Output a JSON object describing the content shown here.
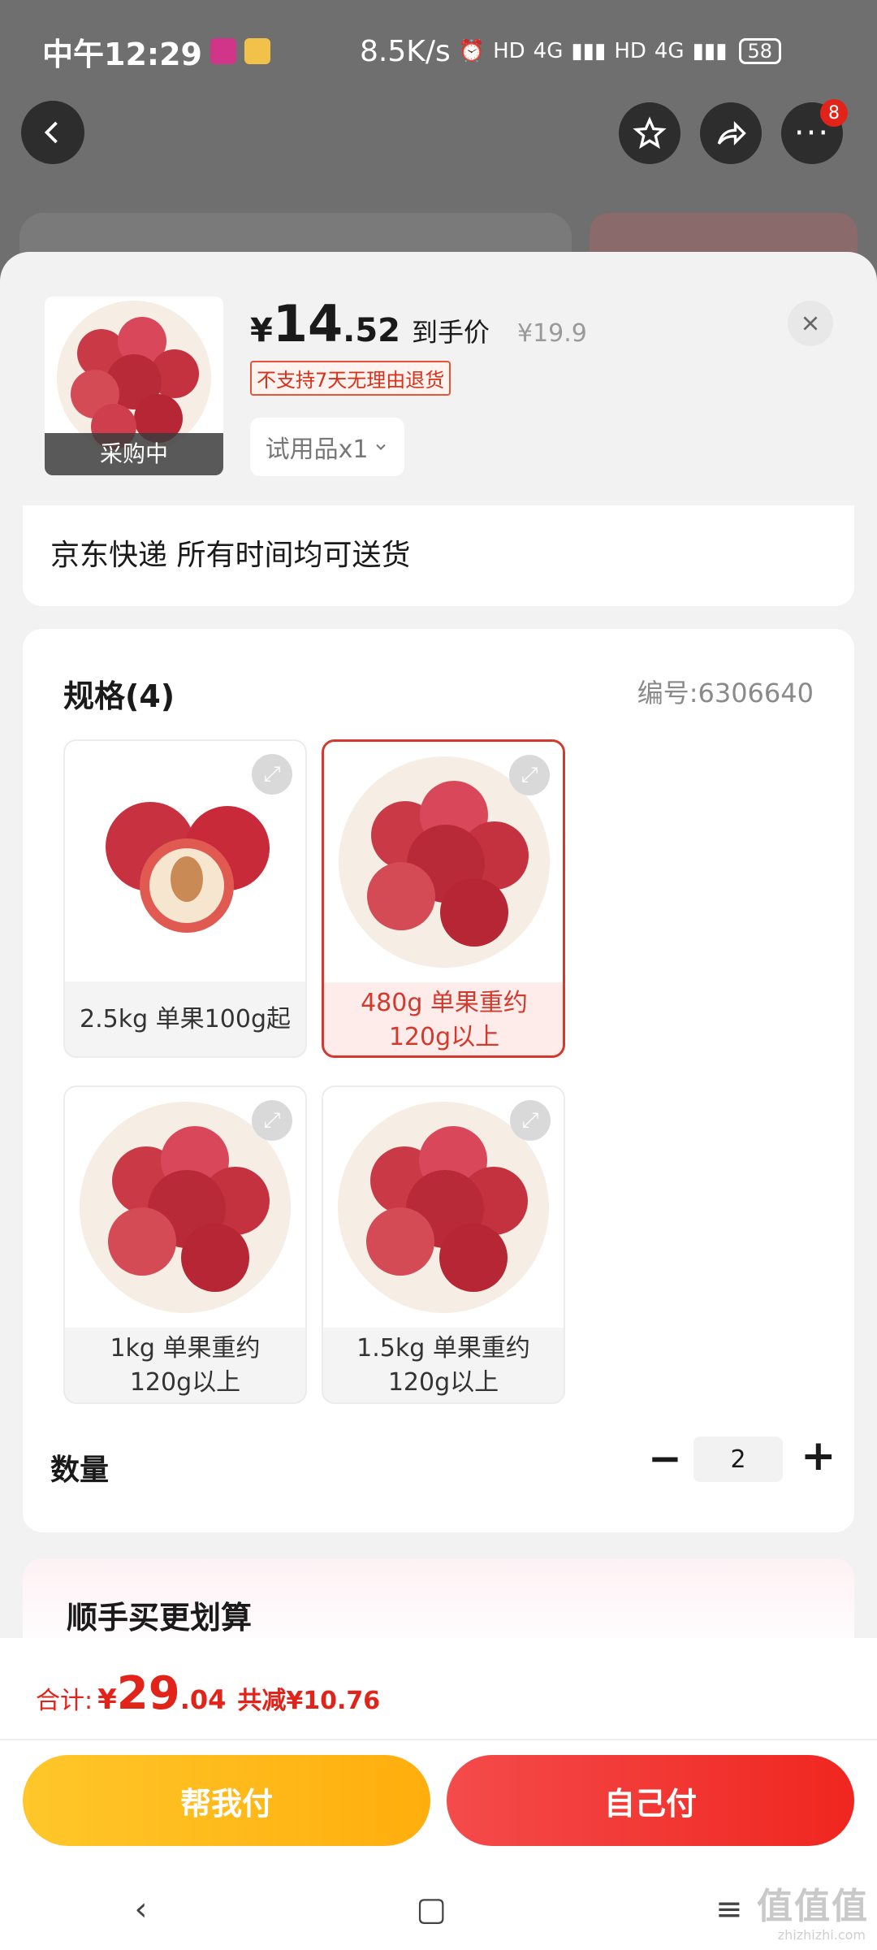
{
  "status_bar": {
    "time": "中午12:29",
    "net_speed": "8.5K/s",
    "signal_1": "4G",
    "signal_2": "4G",
    "hd": "HD",
    "battery": "58"
  },
  "top_actions": {
    "more_badge": "8"
  },
  "product": {
    "currency": "¥",
    "price_int": "14",
    "price_dec": ".52",
    "price_tag": "到手价",
    "original_price": "¥19.9",
    "no_return_notice": "不支持7天无理由退货",
    "thumb_label": "采购中",
    "trial_selector": "试用品x1"
  },
  "delivery": {
    "text": "京东快递 所有时间均可送货"
  },
  "spec": {
    "title": "规格(4)",
    "code": "编号:6306640",
    "options": [
      {
        "label": "2.5kg 单果100g起",
        "selected": false
      },
      {
        "label": "480g 单果重约120g以上",
        "selected": true
      },
      {
        "label": "1kg 单果重约120g以上",
        "selected": false
      },
      {
        "label": "1.5kg 单果重约120g以上",
        "selected": false
      }
    ]
  },
  "quantity": {
    "label": "数量",
    "value": "2",
    "minus": "−",
    "plus": "+"
  },
  "upsell": {
    "title": "顺手买更划算"
  },
  "checkout": {
    "total_label": "合计:",
    "currency": "¥",
    "total_int": "29",
    "total_dec": ".04",
    "savings": "共减¥10.76",
    "help_pay": "帮我付",
    "self_pay": "自己付"
  },
  "watermark": {
    "main": "值值值",
    "sub": "zhizhizhi.com"
  },
  "colors": {
    "accent_red": "#e2231a",
    "yellow": "#ffb81c",
    "selected_border": "#d23a2e"
  }
}
